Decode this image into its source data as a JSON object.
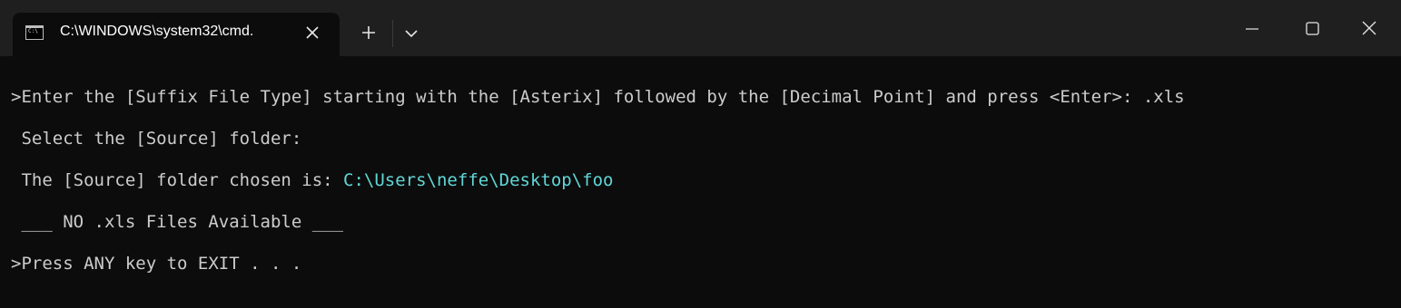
{
  "tab": {
    "title": "C:\\WINDOWS\\system32\\cmd.",
    "icon": "cmd-icon",
    "close_icon": "close-icon"
  },
  "toolbar": {
    "new_tab_icon": "plus-icon",
    "dropdown_icon": "chevron-down-icon"
  },
  "window_controls": {
    "minimize_icon": "minimize-icon",
    "maximize_icon": "maximize-icon",
    "close_icon": "close-icon"
  },
  "terminal": {
    "line1": ">Enter the [Suffix File Type] starting with the [Asterix] followed by the [Decimal Point] and press <Enter>: .xls",
    "line2": " Select the [Source] folder:",
    "line3_prefix": " The [Source] folder chosen is: ",
    "line3_path": "C:\\Users\\neffe\\Desktop\\foo",
    "line4": " ___ NO .xls Files Available ___",
    "line5": ">Press ANY key to EXIT . . ."
  },
  "colors": {
    "background": "#0c0c0c",
    "titlebar": "#1f1f1f",
    "text": "#cccccc",
    "path": "#61d6d6"
  }
}
